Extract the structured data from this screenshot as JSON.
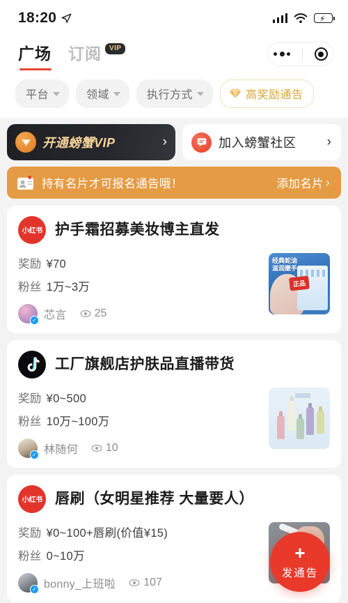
{
  "status_bar": {
    "time": "18:20",
    "location_icon": "location-arrow-icon",
    "signal_icon": "cellular-signal-icon",
    "wifi_icon": "wifi-icon",
    "battery_icon": "battery-charging-icon"
  },
  "header": {
    "tabs": [
      {
        "label": "广场",
        "active": true
      },
      {
        "label": "订阅",
        "active": false,
        "badge": "VIP"
      }
    ],
    "capsule": {
      "menu_icon": "more-dots-icon",
      "close_icon": "target-circle-icon"
    }
  },
  "filters": [
    {
      "label": "平台",
      "type": "dropdown"
    },
    {
      "label": "领域",
      "type": "dropdown"
    },
    {
      "label": "执行方式",
      "type": "dropdown"
    },
    {
      "label": "高奖励通告",
      "type": "highlight",
      "icon": "diamond-icon",
      "color": "#d8a43a"
    }
  ],
  "promos": {
    "vip": {
      "label": "开通螃蟹VIP",
      "icon": "vip-gem-icon",
      "arrow": "›"
    },
    "community": {
      "label": "加入螃蟹社区",
      "icon": "chat-bubble-icon",
      "arrow": "›"
    }
  },
  "notice": {
    "icon": "id-card-icon",
    "text": "持有名片才可报名通告哦！",
    "action": "添加名片",
    "action_arrow": "›",
    "background": "#e59b43"
  },
  "labels": {
    "reward": "奖励",
    "fans": "粉丝",
    "views_icon": "eye-icon",
    "verified_icon": "verified-check-icon"
  },
  "cards": [
    {
      "platform": "小红书",
      "platform_type": "xhs",
      "title": "护手霜招募美妆博主直发",
      "reward": "¥70",
      "fans": "1万~3万",
      "author": "芯言",
      "verified": true,
      "views": "25",
      "thumb_alt": "经典蛇油 滋润嫩手",
      "thumb_caption": "经典蛇油\n滋润嫩手",
      "thumb_seal": "正品"
    },
    {
      "platform": "抖音",
      "platform_type": "douyin",
      "title": "工厂旗舰店护肤品直播带货",
      "reward": "¥0~500",
      "fans": "10万~100万",
      "author": "林随何",
      "verified": true,
      "views": "10",
      "thumb_alt": "护肤品瓶装组合"
    },
    {
      "platform": "小红书",
      "platform_type": "xhs",
      "title": "唇刷（女明星推荐 大量要人）",
      "reward": "¥0~100+唇刷(价值¥15)",
      "fans": "0~10万",
      "author": "bonny_上班啦",
      "verified": true,
      "views": "107",
      "thumb_alt": "手持唇刷"
    }
  ],
  "fab": {
    "plus": "+",
    "label": "发通告",
    "color": "#e8392b"
  }
}
